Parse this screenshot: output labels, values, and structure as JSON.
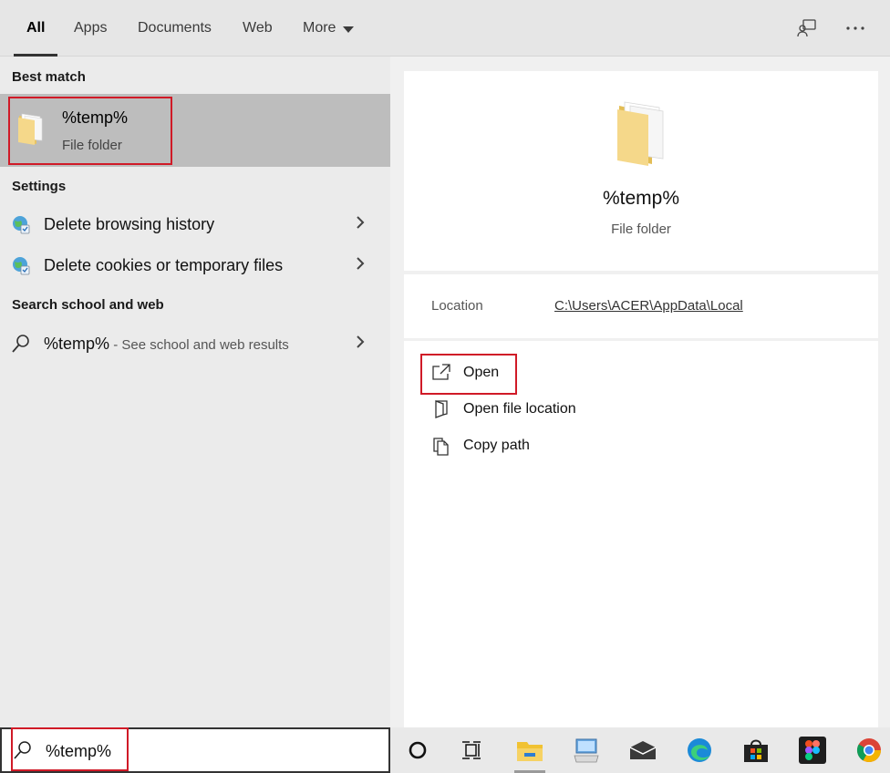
{
  "tabs": [
    {
      "label": "All",
      "active": true
    },
    {
      "label": "Apps"
    },
    {
      "label": "Documents"
    },
    {
      "label": "Web"
    },
    {
      "label": "More"
    }
  ],
  "top_icons": [
    "feedback-icon",
    "more-options-icon"
  ],
  "left": {
    "best_match_label": "Best match",
    "best_match": {
      "title": "%temp%",
      "subtitle": "File folder",
      "icon": "folder-icon"
    },
    "settings_label": "Settings",
    "settings_items": [
      {
        "label": "Delete browsing history",
        "icon": "globe-settings-icon"
      },
      {
        "label": "Delete cookies or temporary files",
        "icon": "globe-settings-icon"
      }
    ],
    "web_label": "Search school and web",
    "web_item": {
      "query": "%temp%",
      "suffix": " - See school and web results",
      "icon": "search-icon"
    }
  },
  "right": {
    "title": "%temp%",
    "subtitle": "File folder",
    "location_label": "Location",
    "location_value": "C:\\Users\\ACER\\AppData\\Local",
    "actions": [
      {
        "label": "Open",
        "icon": "open-external-icon"
      },
      {
        "label": "Open file location",
        "icon": "file-location-icon"
      },
      {
        "label": "Copy path",
        "icon": "copy-icon"
      }
    ]
  },
  "search": {
    "value": "%temp%",
    "icon": "search-icon"
  },
  "taskbar": [
    "cortana-icon",
    "task-view-icon",
    "file-explorer-icon",
    "control-panel-icon",
    "mail-icon",
    "edge-icon",
    "store-icon",
    "figma-icon",
    "chrome-icon"
  ],
  "colors": {
    "highlight_box": "#d01a27",
    "best_match_bg": "#bdbdbd",
    "folder": "#f5d88a"
  }
}
